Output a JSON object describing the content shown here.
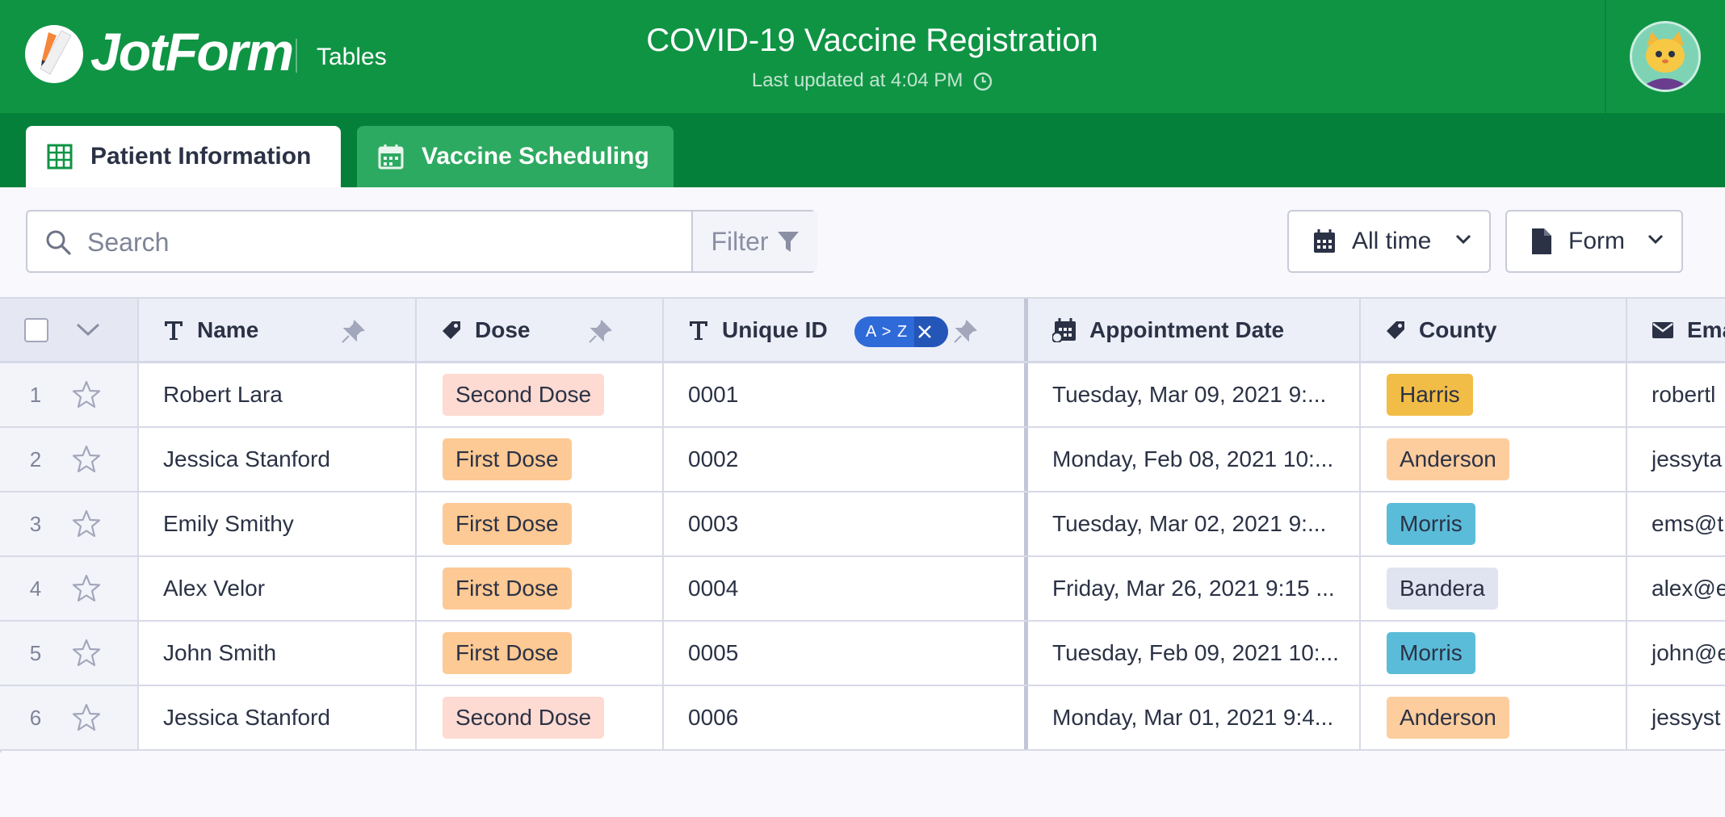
{
  "header": {
    "logo_text": "JotForm",
    "section": "Tables",
    "title": "COVID-19 Vaccine Registration",
    "subtitle": "Last updated at 4:04 PM"
  },
  "tabs": [
    {
      "label": "Patient Information",
      "active": true
    },
    {
      "label": "Vaccine Scheduling",
      "active": false
    }
  ],
  "toolbar": {
    "search_placeholder": "Search",
    "filter_label": "Filter",
    "time_filter": "All time",
    "view_selector": "Form"
  },
  "table": {
    "columns": [
      {
        "label": "Name",
        "icon": "text-type-icon"
      },
      {
        "label": "Dose",
        "icon": "tag-icon"
      },
      {
        "label": "Unique ID",
        "icon": "text-type-icon",
        "sort": "A > Z"
      },
      {
        "label": "Appointment Date",
        "icon": "calendar-icon"
      },
      {
        "label": "County",
        "icon": "tag-icon"
      },
      {
        "label": "Ema",
        "icon": "envelope-icon"
      }
    ],
    "rows": [
      {
        "num": "1",
        "name": "Robert Lara",
        "dose": "Second Dose",
        "id": "0001",
        "date": "Tuesday, Mar 09, 2021 9:...",
        "county": "Harris",
        "email": "robertl"
      },
      {
        "num": "2",
        "name": "Jessica Stanford",
        "dose": "First Dose",
        "id": "0002",
        "date": "Monday, Feb 08, 2021 10:...",
        "county": "Anderson",
        "email": "jessyta"
      },
      {
        "num": "3",
        "name": "Emily Smithy",
        "dose": "First Dose",
        "id": "0003",
        "date": "Tuesday, Mar 02, 2021 9:...",
        "county": "Morris",
        "email": "ems@t"
      },
      {
        "num": "4",
        "name": "Alex Velor",
        "dose": "First Dose",
        "id": "0004",
        "date": "Friday, Mar 26, 2021 9:15 ...",
        "county": "Bandera",
        "email": "alex@e"
      },
      {
        "num": "5",
        "name": "John Smith",
        "dose": "First Dose",
        "id": "0005",
        "date": "Tuesday, Feb 09, 2021 10:...",
        "county": "Morris",
        "email": "john@e"
      },
      {
        "num": "6",
        "name": "Jessica Stanford",
        "dose": "Second Dose",
        "id": "0006",
        "date": "Monday, Mar 01, 2021 9:4...",
        "county": "Anderson",
        "email": "jessyst"
      }
    ]
  },
  "colors": {
    "header_green": "#0f9444",
    "tabbar_green": "#05803a",
    "dose_second": "#fddad2",
    "dose_first": "#fdc994",
    "county_harris": "#f2bd47",
    "county_anderson": "#fdcd9e",
    "county_morris": "#5bbcd9",
    "county_bandera": "#e0e4f0",
    "sort_badge": "#2f6ad9"
  }
}
